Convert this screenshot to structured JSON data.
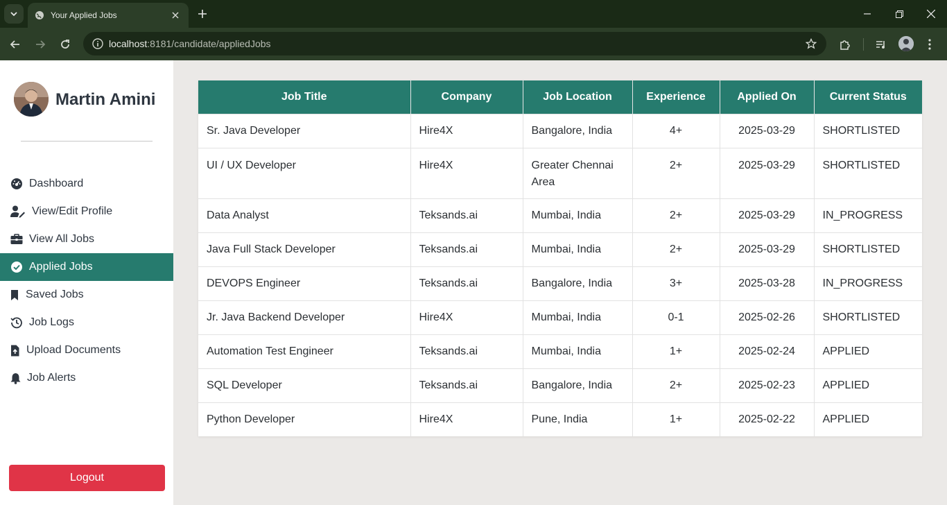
{
  "browser": {
    "tab_title": "Your Applied Jobs",
    "url_host": "localhost",
    "url_rest": ":8181/candidate/appliedJobs"
  },
  "sidebar": {
    "user_name": "Martin Amini",
    "items": [
      {
        "label": "Dashboard",
        "icon": "dashboard-icon"
      },
      {
        "label": "View/Edit Profile",
        "icon": "user-edit-icon"
      },
      {
        "label": "View All Jobs",
        "icon": "briefcase-icon"
      },
      {
        "label": "Applied Jobs",
        "icon": "check-circle-icon",
        "active": true
      },
      {
        "label": "Saved Jobs",
        "icon": "bookmark-icon"
      },
      {
        "label": "Job Logs",
        "icon": "history-icon"
      },
      {
        "label": "Upload Documents",
        "icon": "file-upload-icon"
      },
      {
        "label": "Job Alerts",
        "icon": "bell-icon"
      }
    ],
    "logout_label": "Logout"
  },
  "table": {
    "headers": [
      "Job Title",
      "Company",
      "Job Location",
      "Experience",
      "Applied On",
      "Current Status"
    ],
    "rows": [
      [
        "Sr. Java Developer",
        "Hire4X",
        "Bangalore, India",
        "4+",
        "2025-03-29",
        "SHORTLISTED"
      ],
      [
        "UI / UX Developer",
        "Hire4X",
        "Greater Chennai Area",
        "2+",
        "2025-03-29",
        "SHORTLISTED"
      ],
      [
        "Data Analyst",
        "Teksands.ai",
        "Mumbai, India",
        "2+",
        "2025-03-29",
        "IN_PROGRESS"
      ],
      [
        "Java Full Stack Developer",
        "Teksands.ai",
        "Mumbai, India",
        "2+",
        "2025-03-29",
        "SHORTLISTED"
      ],
      [
        "DEVOPS Engineer",
        "Teksands.ai",
        "Bangalore, India",
        "3+",
        "2025-03-28",
        "IN_PROGRESS"
      ],
      [
        "Jr. Java Backend Developer",
        "Hire4X",
        "Mumbai, India",
        "0-1",
        "2025-02-26",
        "SHORTLISTED"
      ],
      [
        "Automation Test Engineer",
        "Teksands.ai",
        "Mumbai, India",
        "1+",
        "2025-02-24",
        "APPLIED"
      ],
      [
        "SQL Developer",
        "Teksands.ai",
        "Bangalore, India",
        "2+",
        "2025-02-23",
        "APPLIED"
      ],
      [
        "Python Developer",
        "Hire4X",
        "Pune, India",
        "1+",
        "2025-02-22",
        "APPLIED"
      ]
    ]
  },
  "colors": {
    "accent": "#267b6e",
    "logout": "#e03447",
    "chrome_dark": "#1a2a16",
    "chrome_toolbar": "#2c3e28"
  }
}
